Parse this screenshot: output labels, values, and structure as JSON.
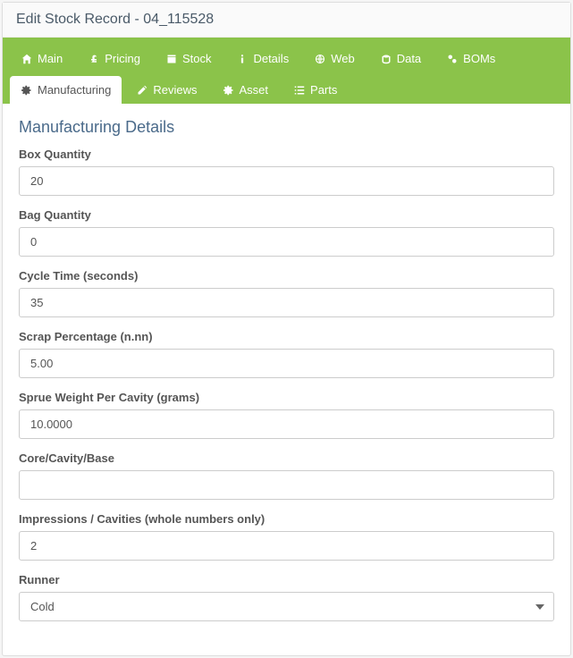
{
  "page_title": "Edit Stock Record - 04_115528",
  "tabs": {
    "main": "Main",
    "pricing": "Pricing",
    "stock": "Stock",
    "details": "Details",
    "web": "Web",
    "data": "Data",
    "boms": "BOMs",
    "manufacturing": "Manufacturing",
    "reviews": "Reviews",
    "asset": "Asset",
    "parts": "Parts"
  },
  "active_tab": "manufacturing",
  "section_title": "Manufacturing Details",
  "fields": {
    "box_quantity": {
      "label": "Box Quantity",
      "value": "20"
    },
    "bag_quantity": {
      "label": "Bag Quantity",
      "value": "0"
    },
    "cycle_time": {
      "label": "Cycle Time (seconds)",
      "value": "35"
    },
    "scrap_percentage": {
      "label": "Scrap Percentage (n.nn)",
      "value": "5.00"
    },
    "sprue_weight": {
      "label": "Sprue Weight Per Cavity (grams)",
      "value": "10.0000"
    },
    "core_cavity_base": {
      "label": "Core/Cavity/Base",
      "value": ""
    },
    "impressions": {
      "label": "Impressions / Cavities (whole numbers only)",
      "value": "2"
    },
    "runner": {
      "label": "Runner",
      "value": "Cold"
    }
  }
}
